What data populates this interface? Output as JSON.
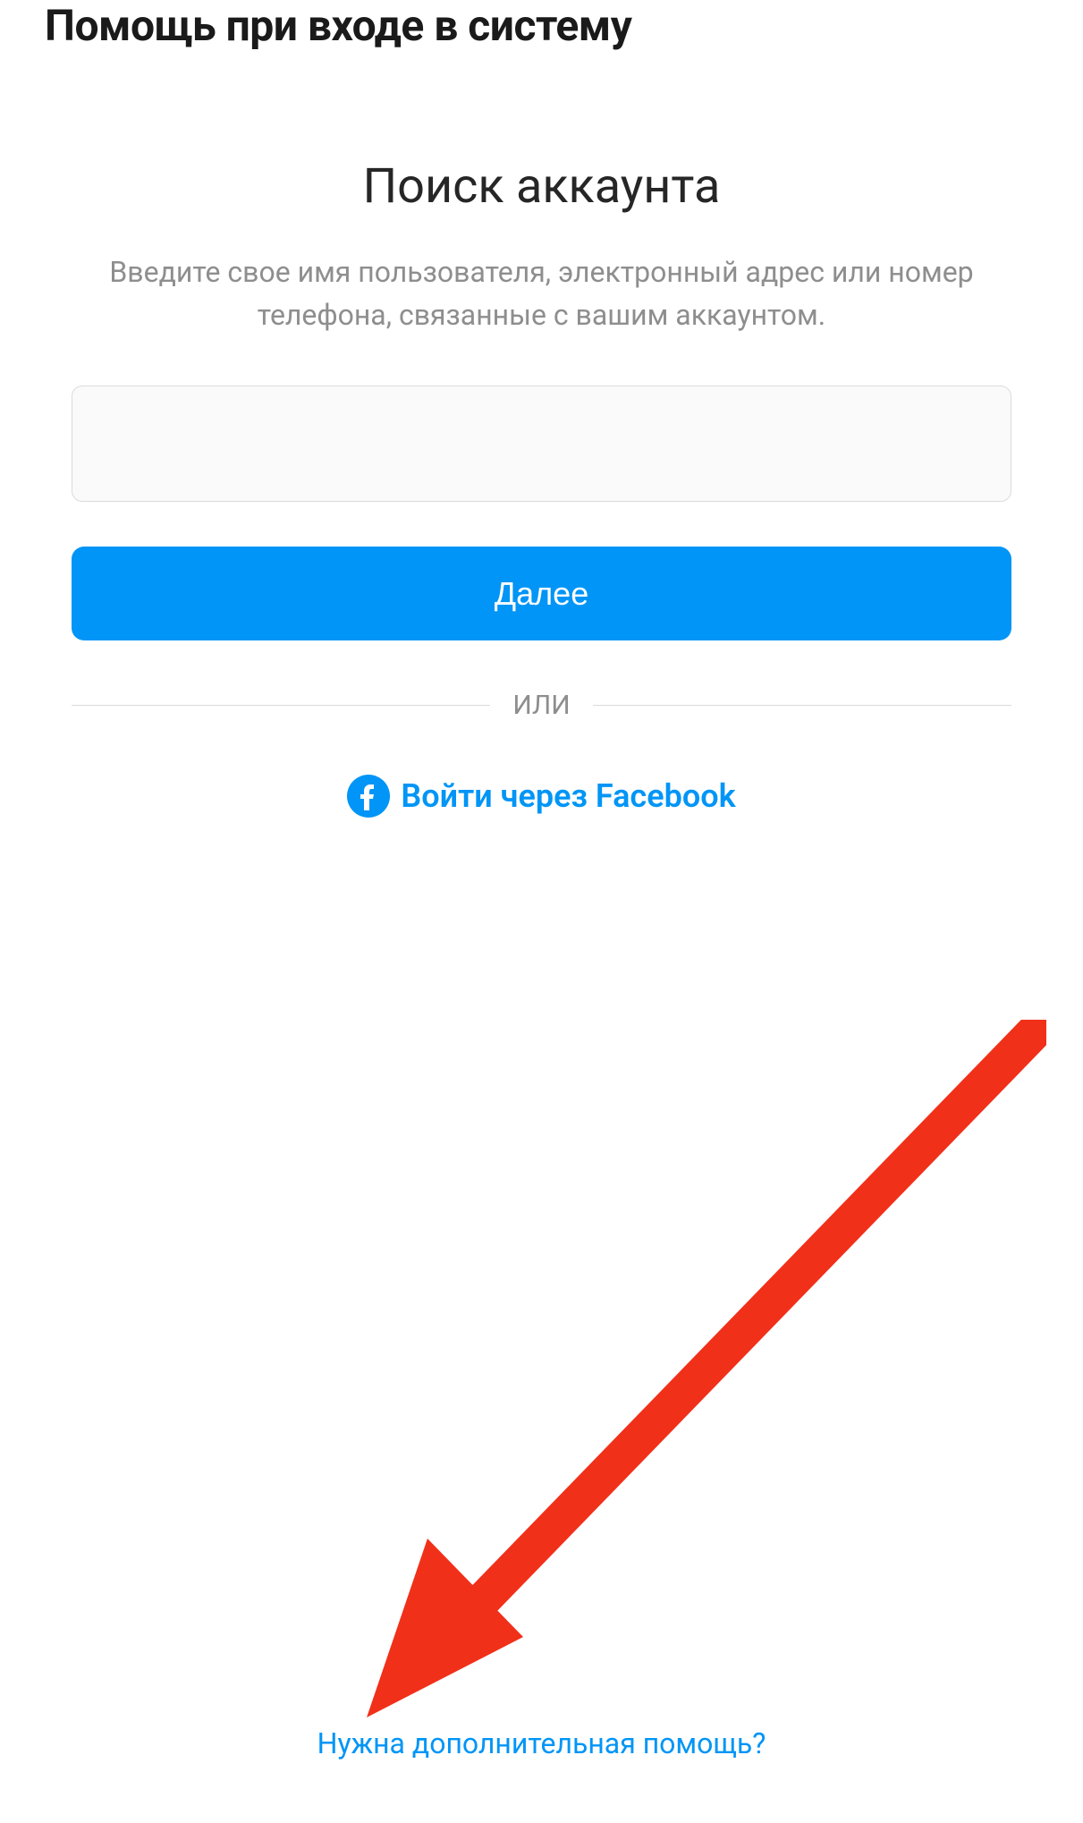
{
  "header": {
    "title": "Помощь при входе в систему"
  },
  "main": {
    "title": "Поиск аккаунта",
    "subtitle": "Введите свое имя пользователя, электронный адрес или номер телефона, связанные с вашим аккаунтом.",
    "input_value": "",
    "next_button": "Далее",
    "divider": "или",
    "fb_login": "Войти через Facebook"
  },
  "footer": {
    "help_link": "Нужна дополнительная помощь?"
  },
  "colors": {
    "primary": "#0095f6",
    "text_muted": "#8e8e8e",
    "border": "#dbdbdb",
    "input_bg": "#fafafa",
    "arrow": "#f1301a"
  }
}
